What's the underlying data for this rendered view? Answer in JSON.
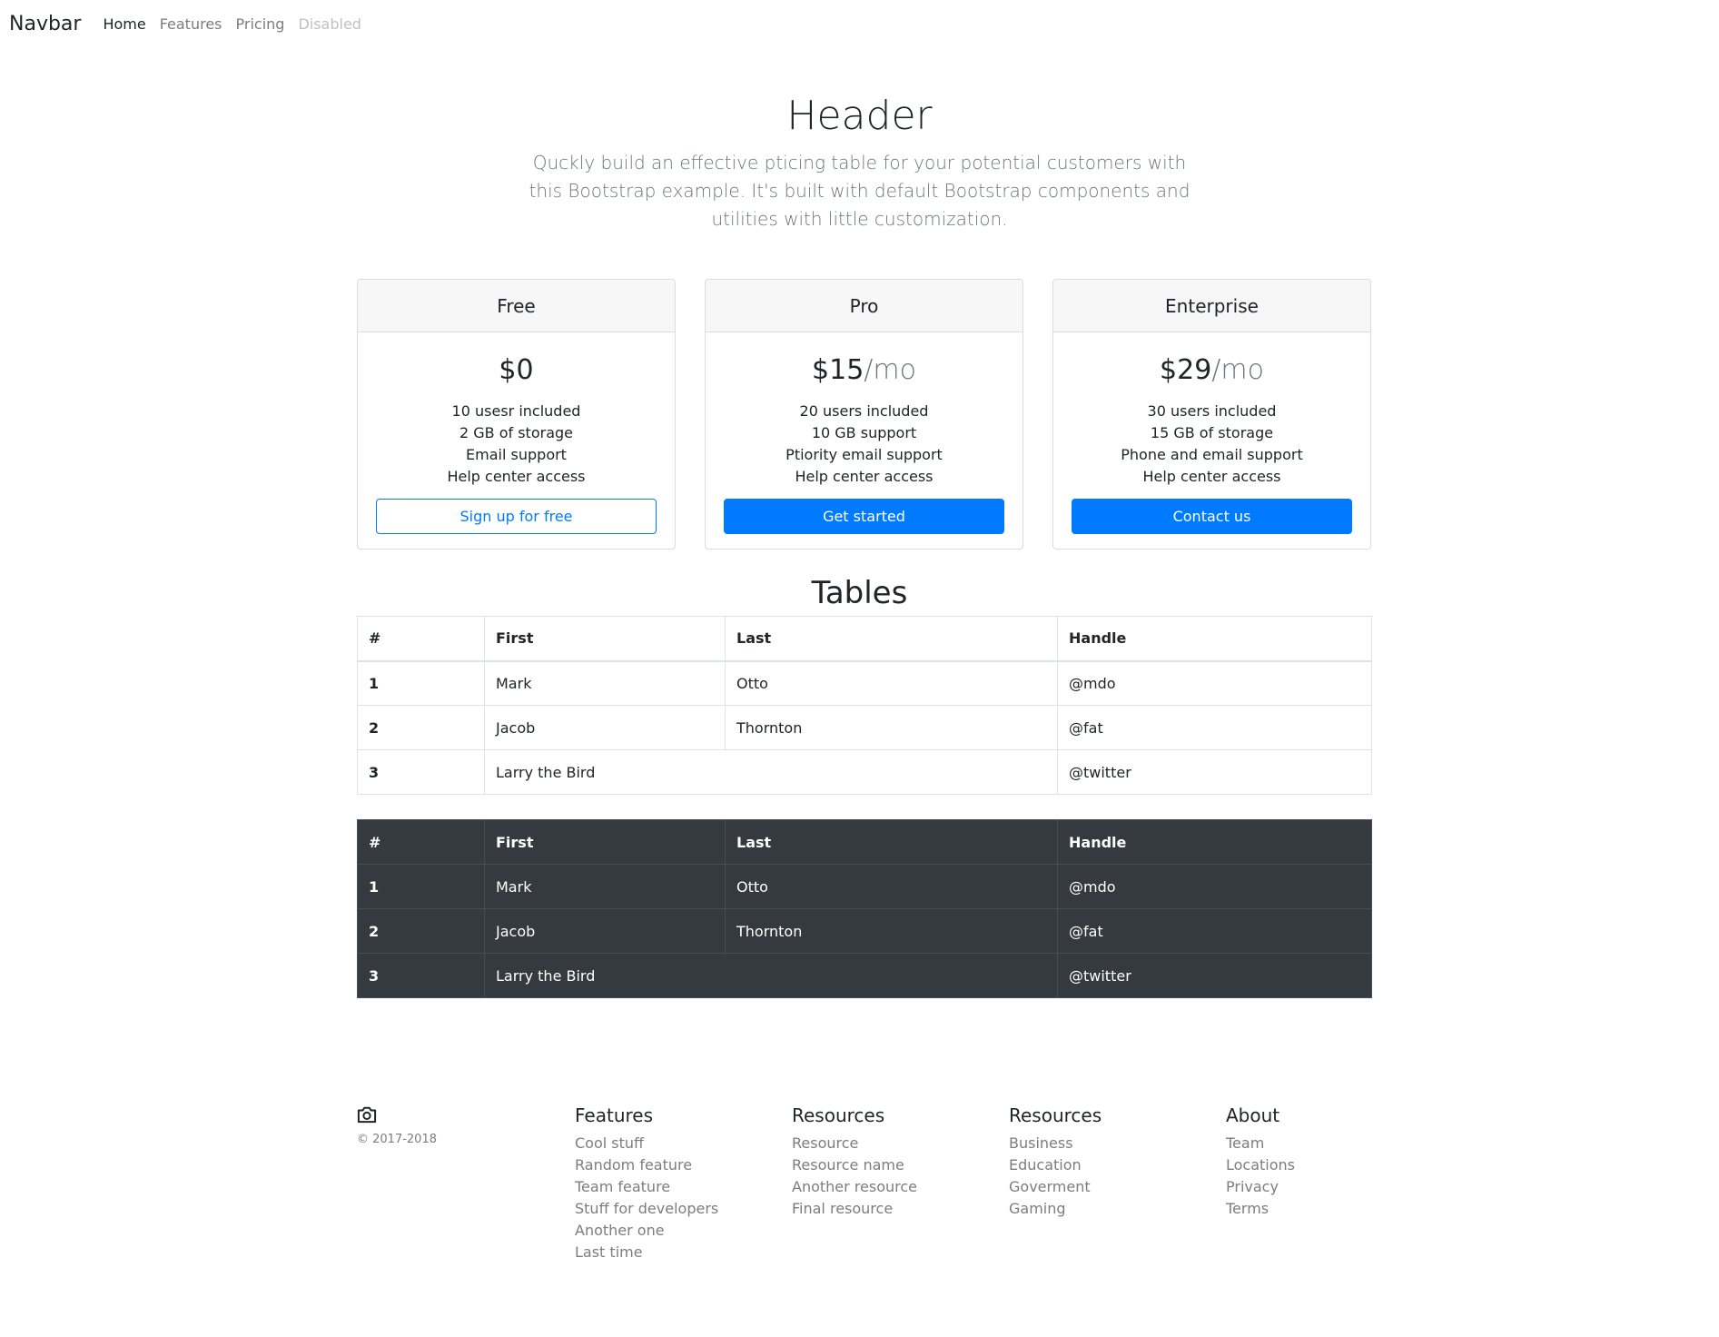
{
  "navbar": {
    "brand": "Navbar",
    "links": [
      "Home",
      "Features",
      "Pricing",
      "Disabled"
    ]
  },
  "hero": {
    "title": "Header",
    "lead": "Quckly build an effective pticing table for your potential customers with this Bootstrap example. It's built with default Bootstrap components and utilities with little customization."
  },
  "plans": [
    {
      "name": "Free",
      "price": "$0",
      "per": "",
      "features": [
        "10 usesr included",
        "2 GB of storage",
        "Email support",
        "Help center access"
      ],
      "button": "Sign up for free"
    },
    {
      "name": "Pro",
      "price": "$15",
      "per": "/mo",
      "features": [
        "20 users included",
        "10 GB support",
        "Ptiority email support",
        "Help center access"
      ],
      "button": "Get started"
    },
    {
      "name": "Enterprise",
      "price": "$29",
      "per": "/mo",
      "features": [
        "30 users included",
        "15 GB of storage",
        "Phone and email support",
        "Help center access"
      ],
      "button": "Contact us"
    }
  ],
  "tables": {
    "title": "Tables",
    "headers": [
      "#",
      "First",
      "Last",
      "Handle"
    ],
    "rows": [
      {
        "num": "1",
        "first": "Mark",
        "last": "Otto",
        "handle": "@mdo"
      },
      {
        "num": "2",
        "first": "Jacob",
        "last": "Thornton",
        "handle": "@fat"
      },
      {
        "num": "3",
        "first": "Larry the Bird",
        "last": "",
        "handle": "@twitter"
      }
    ]
  },
  "footer": {
    "copyright": "© 2017-2018",
    "logo_icon": "camera-icon",
    "columns": [
      {
        "title": "Features",
        "links": [
          "Cool stuff",
          "Random feature",
          "Team feature",
          "Stuff for developers",
          "Another one",
          "Last time"
        ]
      },
      {
        "title": "Resources",
        "links": [
          "Resource",
          "Resource name",
          "Another resource",
          "Final resource"
        ]
      },
      {
        "title": "Resources",
        "links": [
          "Business",
          "Education",
          "Goverment",
          "Gaming"
        ]
      },
      {
        "title": "About",
        "links": [
          "Team",
          "Locations",
          "Privacy",
          "Terms"
        ]
      }
    ]
  },
  "colors": {
    "primary": "#007bff",
    "dark_table": "#343a40",
    "muted": "#6c757d"
  }
}
